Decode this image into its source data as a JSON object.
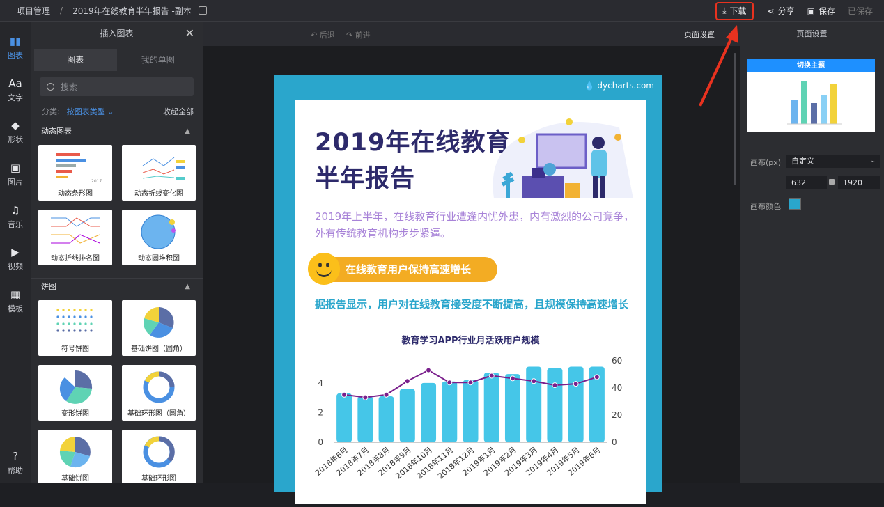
{
  "topbar": {
    "breadcrumb_root": "项目管理",
    "separator": "/",
    "doc_title": "2019年在线教育半年报告 -副本",
    "download": "下载",
    "share": "分享",
    "save": "保存",
    "saved_status": "已保存"
  },
  "rail": {
    "items": [
      {
        "label": "图表",
        "icon": "chart-icon",
        "glyph": "▮▮"
      },
      {
        "label": "文字",
        "icon": "text-icon",
        "glyph": "Aa"
      },
      {
        "label": "形状",
        "icon": "shape-icon",
        "glyph": "◆"
      },
      {
        "label": "图片",
        "icon": "image-icon",
        "glyph": "▣"
      },
      {
        "label": "音乐",
        "icon": "music-icon",
        "glyph": "♫"
      },
      {
        "label": "视频",
        "icon": "video-icon",
        "glyph": "▶"
      },
      {
        "label": "模板",
        "icon": "template-icon",
        "glyph": "▦"
      },
      {
        "label": "帮助",
        "icon": "help-icon",
        "glyph": "?"
      }
    ]
  },
  "panel": {
    "title": "插入图表",
    "tabs": [
      "图表",
      "我的单图"
    ],
    "search_placeholder": "搜索",
    "filter_label": "分类:",
    "filter_value": "按图表类型",
    "collapse_all": "收起全部",
    "sections": [
      {
        "title": "动态图表",
        "cards": [
          "动态条形图",
          "动态折线变化图",
          "动态折线排名图",
          "动态圆堆积图"
        ]
      },
      {
        "title": "饼图",
        "cards": [
          "符号饼图",
          "基础饼图（圆角）",
          "变形饼图",
          "基础环形图（圆角）",
          "基础饼图",
          "基础环形图"
        ]
      }
    ]
  },
  "canvas": {
    "undo": "后退",
    "redo": "前进",
    "page_settings": "页面设置",
    "brand": "dycharts.com",
    "poster": {
      "title_line1": "2019年在线教育",
      "title_line2": "半年报告",
      "subtitle": "2019年上半年，在线教育行业遭逢内忧外患，内有激烈的公司竞争，外有传统教育机构步步紧逼。",
      "pill": "在线教育用户保持高速增长",
      "text": "据报告显示，用户对在线教育接受度不断提高，且规模保持高速增长",
      "chart_title": "教育学习APP行业月活跃用户规模"
    }
  },
  "chart_data": {
    "type": "bar",
    "title": "教育学习APP行业月活跃用户规模",
    "categories": [
      "2018年6月",
      "2018年7月",
      "2018年8月",
      "2018年9月",
      "2018年10月",
      "2018年11月",
      "2018年12月",
      "2019年1月",
      "2019年2月",
      "2019年3月",
      "2019年4月",
      "2019年5月",
      "2019年6月"
    ],
    "series": [
      {
        "type": "bar",
        "axis": "left",
        "values": [
          3.3,
          3.1,
          3.1,
          3.6,
          4.0,
          4.1,
          4.2,
          4.7,
          4.6,
          5.1,
          5.0,
          5.1,
          5.1
        ],
        "color": "#45c6e8"
      },
      {
        "type": "line",
        "axis": "right",
        "values": [
          35,
          33,
          35,
          45,
          53,
          44,
          44,
          49,
          47,
          45,
          42,
          43,
          48
        ],
        "color": "#7a1f8c"
      }
    ],
    "y_left": {
      "ticks": [
        0,
        2,
        4
      ],
      "ylim": [
        0,
        5.5
      ]
    },
    "y_right": {
      "ticks": [
        0,
        20,
        40,
        60
      ],
      "ylim": [
        0,
        60
      ]
    }
  },
  "right_panel": {
    "title": "页面设置",
    "theme_button": "切换主题",
    "canvas_label": "画布(px)",
    "canvas_preset": "自定义",
    "width": "632",
    "height": "1920",
    "color_label": "画布颜色",
    "canvas_color": "#2aa6cc"
  }
}
